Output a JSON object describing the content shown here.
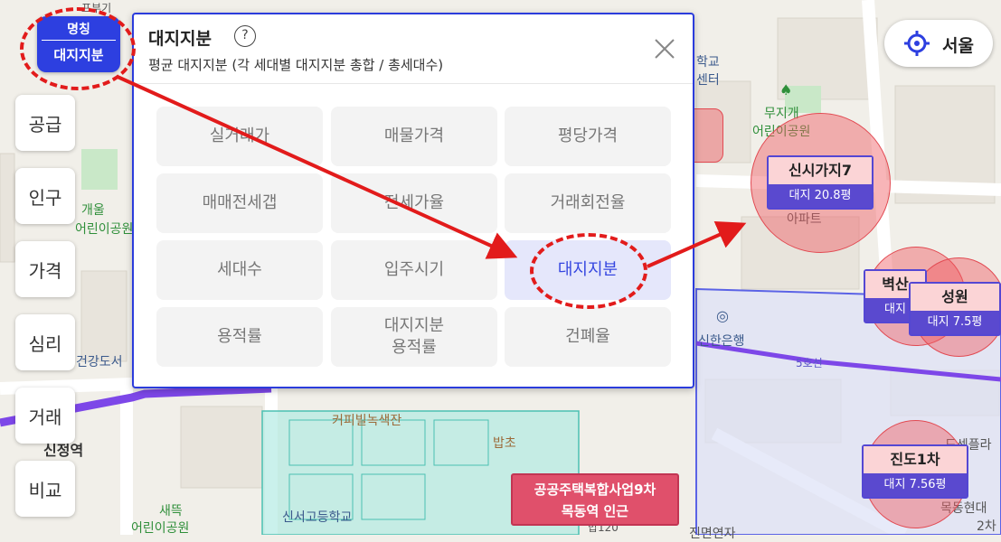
{
  "layer_button": {
    "top_label": "명칭",
    "bottom_label": "대지지분"
  },
  "side_menu": [
    "공급",
    "인구",
    "가격",
    "심리",
    "거래",
    "비교"
  ],
  "popup": {
    "title": "대지지분",
    "help_symbol": "?",
    "subtitle": "평균 대지지분 (각 세대별 대지지분 총합 / 총세대수)",
    "options": [
      {
        "label": "실거래가",
        "selected": false
      },
      {
        "label": "매물가격",
        "selected": false
      },
      {
        "label": "평당가격",
        "selected": false
      },
      {
        "label": "매매전세갭",
        "selected": false
      },
      {
        "label": "전세가율",
        "selected": false
      },
      {
        "label": "거래회전율",
        "selected": false
      },
      {
        "label": "세대수",
        "selected": false
      },
      {
        "label": "입주시기",
        "selected": false
      },
      {
        "label": "대지지분",
        "selected": true
      },
      {
        "label": "용적률",
        "selected": false
      },
      {
        "label": "대지지분\n용적률",
        "selected": false
      },
      {
        "label": "건폐율",
        "selected": false
      }
    ]
  },
  "location_button": {
    "label": "서울"
  },
  "markers": [
    {
      "name": "신시가지7",
      "value": "대지 20.8평"
    },
    {
      "name": "성원",
      "value": "대지 7.5평"
    },
    {
      "name": "진도1차",
      "value": "대지 7.56평"
    },
    {
      "name": "벽산",
      "value": "대지"
    }
  ],
  "public_housing": {
    "line1": "공공주택복합사업9차",
    "line2": "목동역 인근"
  },
  "map_labels": {
    "park1": "무지개",
    "park1b": "어린이공원",
    "park2": "개울",
    "park2b": "어린이공원",
    "park3": "새뜩",
    "park3b": "어린이공원",
    "school": "신서고등학교",
    "bank": "신한은행",
    "cafe": "커피빌녹색잔",
    "restaurant": "밥초",
    "station": "신정역",
    "health": "건강도서",
    "line5": "5호선",
    "apt": "아파트",
    "edu": "학교",
    "edu2": "센터",
    "mokdong": "목동현대",
    "mokdong2": "2차",
    "plaza": "드센플라",
    "misc": "진면연자",
    "rest": "밥120",
    "top_left": "프부기"
  },
  "colors": {
    "accent": "#2d3fe0",
    "selected_bg": "#e5e7fb",
    "highlight_red": "#e21b1b",
    "marker_value": "#5a49cf"
  }
}
